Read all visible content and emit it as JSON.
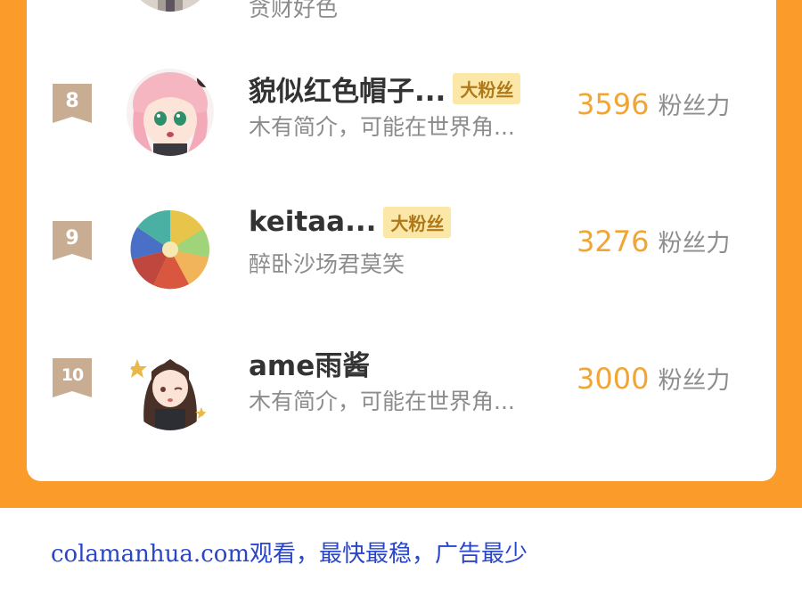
{
  "prev_row": {
    "bio": "贪财好色"
  },
  "rows": [
    {
      "rank": "8",
      "name": "貌似红色帽子...",
      "badge": "大粉丝",
      "bio": "木有简介，可能在世界角...",
      "score": "3596",
      "unit": "粉丝力",
      "avatar": "pink-hair-anime-girl"
    },
    {
      "rank": "9",
      "name": "keitaa...",
      "badge": "大粉丝",
      "bio": "醉卧沙场君莫笑",
      "score": "3276",
      "unit": "粉丝力",
      "avatar": "colorful-mandala"
    },
    {
      "rank": "10",
      "name": "ame雨酱",
      "badge": "",
      "bio": "木有简介，可能在世界角...",
      "score": "3000",
      "unit": "粉丝力",
      "avatar": "chibi-brown-hair-girl"
    }
  ],
  "colors": {
    "orange": "#fb9b2a",
    "score": "#f3a533",
    "badge_bg": "#fbe8a9",
    "rank_bg": "#c8ad92",
    "footer": "#2a46c8"
  },
  "footer": {
    "text": "colamanhua.com观看，最快最稳，广告最少"
  }
}
